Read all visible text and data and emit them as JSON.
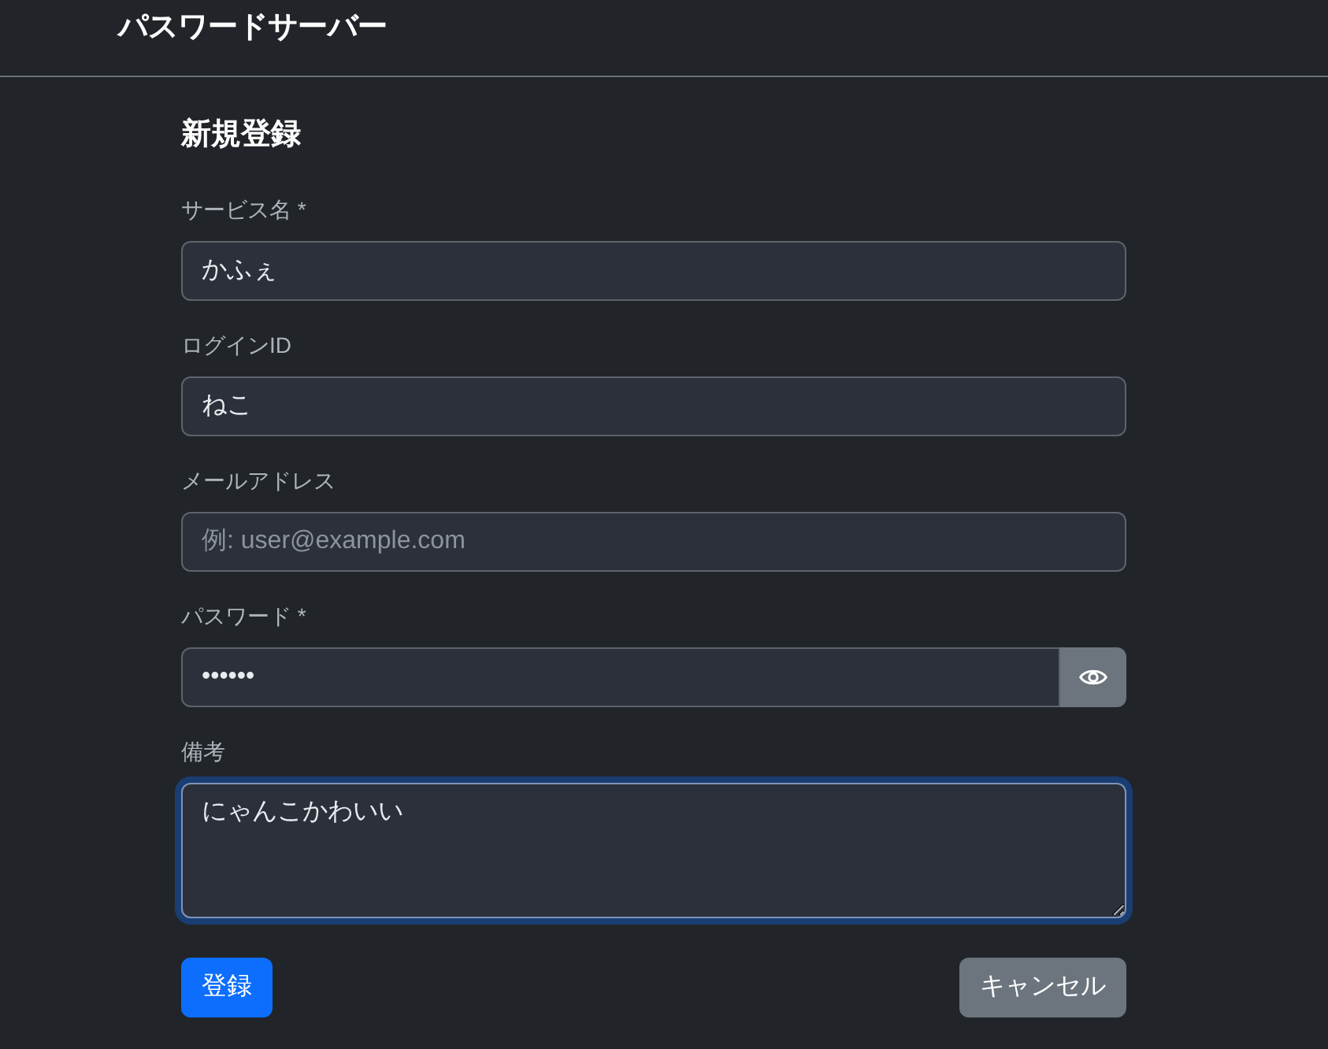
{
  "header": {
    "title": "パスワードサーバー"
  },
  "form": {
    "title": "新規登録",
    "fields": [
      {
        "kind": "text",
        "label": "サービス名 *",
        "value": "かふぇ",
        "focused": false
      },
      {
        "kind": "text",
        "label": "ログインID",
        "value": "ねこ",
        "focused": false
      },
      {
        "kind": "text",
        "label": "メールアドレス",
        "placeholder": "例: user@example.com",
        "focused": false
      },
      {
        "kind": "password",
        "label": "パスワード *",
        "value": "••••••",
        "focused": false
      },
      {
        "kind": "textarea",
        "label": "備考",
        "value": "にゃんこかわいい",
        "focused": true
      }
    ],
    "buttons": [
      {
        "kind": "primary",
        "label": "登録"
      },
      {
        "kind": "secondary",
        "label": "キャンセル"
      }
    ]
  }
}
